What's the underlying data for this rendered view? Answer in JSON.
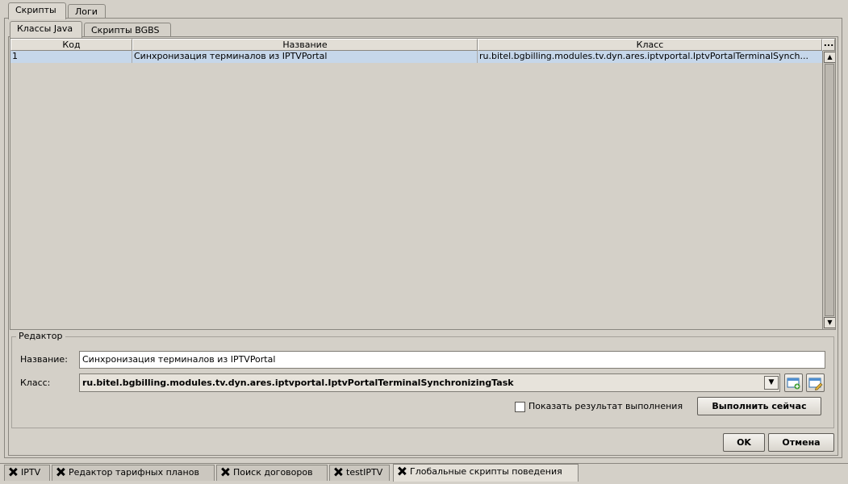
{
  "top_tabs": [
    {
      "label": "Скрипты"
    },
    {
      "label": "Логи"
    }
  ],
  "sub_tabs": [
    {
      "label": "Классы Java"
    },
    {
      "label": "Скрипты BGBS"
    }
  ],
  "table": {
    "columns": [
      "Код",
      "Название",
      "Класс"
    ],
    "more_label": "...",
    "rows": [
      {
        "code": "1",
        "name": "Синхронизация терминалов из IPTVPortal",
        "class": "ru.bitel.bgbilling.modules.tv.dyn.ares.iptvportal.IptvPortalTerminalSynch..."
      }
    ]
  },
  "editor": {
    "legend": "Редактор",
    "name_label": "Название:",
    "name_value": "Синхронизация терминалов из IPTVPortal",
    "class_label": "Класс:",
    "class_value": "ru.bitel.bgbilling.modules.tv.dyn.ares.iptvportal.IptvPortalTerminalSynchronizingTask",
    "show_result_label": "Показать результат выполнения",
    "show_result_checked": false,
    "run_now_label": "Выполнить сейчас"
  },
  "dialog": {
    "ok_label": "OK",
    "cancel_label": "Отмена"
  },
  "bottom_tabs": [
    {
      "label": "IPTV"
    },
    {
      "label": "Редактор тарифных планов"
    },
    {
      "label": "Поиск договоров"
    },
    {
      "label": "testIPTV"
    },
    {
      "label": "Глобальные скрипты поведения"
    }
  ],
  "colors": {
    "selection": "#c6d7ea",
    "background": "#d4d0c8"
  }
}
